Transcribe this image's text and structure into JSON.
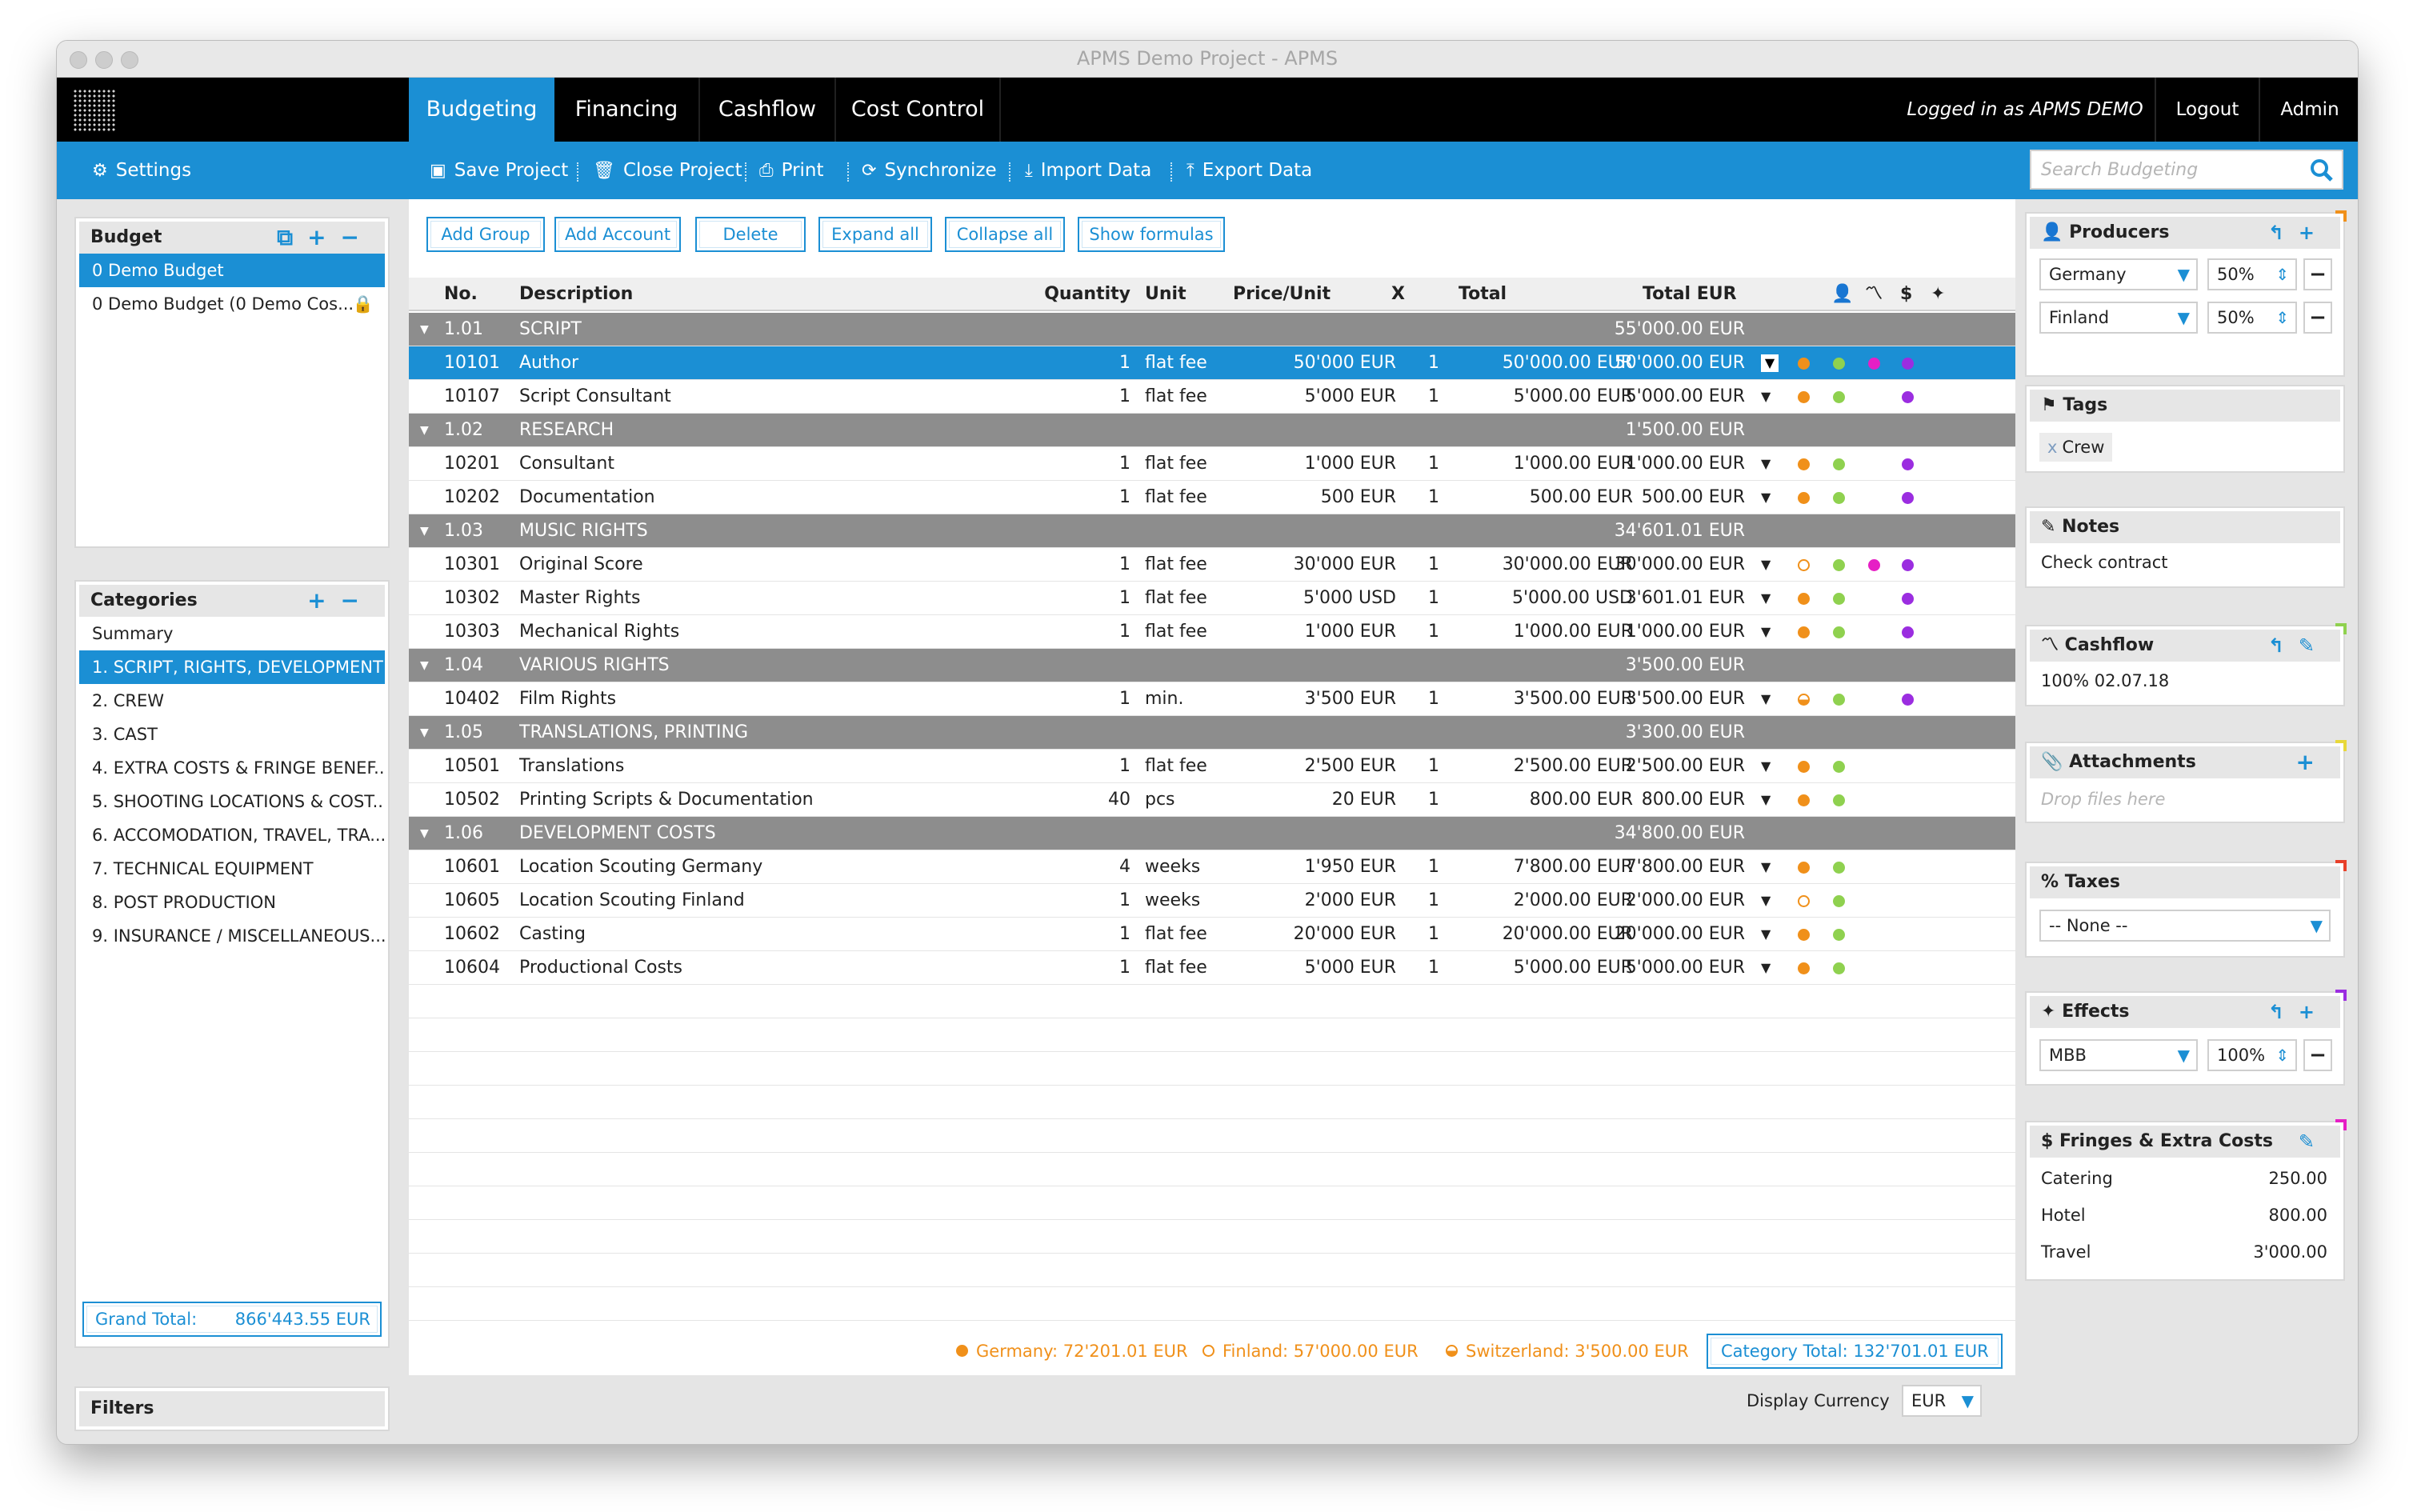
{
  "window": {
    "title": "APMS Demo Project - APMS"
  },
  "nav": {
    "tabs": [
      {
        "label": "Budgeting"
      },
      {
        "label": "Financing"
      },
      {
        "label": "Cashflow"
      },
      {
        "label": "Cost Control"
      }
    ],
    "logged_in": "Logged in as APMS DEMO",
    "logout": "Logout",
    "admin": "Admin"
  },
  "toolbar": {
    "settings": "Settings",
    "save": "Save Project",
    "close": "Close Project",
    "print": "Print",
    "sync": "Synchronize",
    "import": "Import Data",
    "export": "Export Data",
    "search_placeholder": "Search Budgeting"
  },
  "budget": {
    "title": "Budget",
    "items": [
      {
        "label": "0 Demo Budget"
      },
      {
        "label": "0 Demo Budget (0 Demo Cos..."
      }
    ]
  },
  "categories": {
    "title": "Categories",
    "items": [
      {
        "label": "Summary"
      },
      {
        "label": "1. SCRIPT, RIGHTS, DEVELOPMENT"
      },
      {
        "label": "2. CREW"
      },
      {
        "label": "3. CAST"
      },
      {
        "label": "4. EXTRA COSTS & FRINGE BENEF..."
      },
      {
        "label": "5. SHOOTING LOCATIONS & COST..."
      },
      {
        "label": "6. ACCOMODATION, TRAVEL, TRA..."
      },
      {
        "label": "7. TECHNICAL EQUIPMENT"
      },
      {
        "label": "8. POST PRODUCTION"
      },
      {
        "label": "9. INSURANCE / MISCELLANEOUS..."
      }
    ],
    "grand_total_label": "Grand Total:",
    "grand_total_value": "866'443.55 EUR"
  },
  "filters": {
    "title": "Filters"
  },
  "actions": {
    "add_group": "Add Group",
    "add_account": "Add Account",
    "delete": "Delete",
    "expand_all": "Expand all",
    "collapse_all": "Collapse all",
    "show_formulas": "Show formulas"
  },
  "table": {
    "headers": {
      "no": "No.",
      "description": "Description",
      "quantity": "Quantity",
      "unit": "Unit",
      "price": "Price/Unit",
      "x": "X",
      "total": "Total",
      "total_eur": "Total EUR"
    },
    "rows": [
      {
        "type": "group",
        "no": "1.01",
        "desc": "SCRIPT",
        "total_eur": "55'000.00 EUR"
      },
      {
        "type": "item",
        "no": "10101",
        "desc": "Author",
        "qty": "1",
        "unit": "flat fee",
        "price": "50'000 EUR",
        "x": "1",
        "total": "50'000.00 EUR",
        "total_eur": "50'000.00 EUR",
        "country": "germany",
        "dots": [
          "orange",
          "green",
          "magenta",
          "purple"
        ],
        "selected": true
      },
      {
        "type": "item",
        "no": "10107",
        "desc": "Script Consultant",
        "qty": "1",
        "unit": "flat fee",
        "price": "5'000 EUR",
        "x": "1",
        "total": "5'000.00 EUR",
        "total_eur": "5'000.00 EUR",
        "country": "germany",
        "dots": [
          "orange",
          "green",
          "",
          "purple"
        ]
      },
      {
        "type": "group",
        "no": "1.02",
        "desc": "RESEARCH",
        "total_eur": "1'500.00 EUR"
      },
      {
        "type": "item",
        "no": "10201",
        "desc": "Consultant",
        "qty": "1",
        "unit": "flat fee",
        "price": "1'000 EUR",
        "x": "1",
        "total": "1'000.00 EUR",
        "total_eur": "1'000.00 EUR",
        "country": "germany",
        "dots": [
          "orange",
          "green",
          "",
          "purple"
        ]
      },
      {
        "type": "item",
        "no": "10202",
        "desc": "Documentation",
        "qty": "1",
        "unit": "flat fee",
        "price": "500 EUR",
        "x": "1",
        "total": "500.00 EUR",
        "total_eur": "500.00 EUR",
        "country": "germany",
        "dots": [
          "orange",
          "green",
          "",
          "purple"
        ]
      },
      {
        "type": "group",
        "no": "1.03",
        "desc": "MUSIC RIGHTS",
        "total_eur": "34'601.01 EUR"
      },
      {
        "type": "item",
        "no": "10301",
        "desc": "Original Score",
        "qty": "1",
        "unit": "flat fee",
        "price": "30'000 EUR",
        "x": "1",
        "total": "30'000.00 EUR",
        "total_eur": "30'000.00 EUR",
        "country": "finland",
        "dots": [
          "orange",
          "green",
          "magenta",
          "purple"
        ]
      },
      {
        "type": "item",
        "no": "10302",
        "desc": "Master Rights",
        "qty": "1",
        "unit": "flat fee",
        "price": "5'000 USD",
        "x": "1",
        "total": "5'000.00 USD",
        "total_eur": "3'601.01 EUR",
        "country": "germany",
        "dots": [
          "orange",
          "green",
          "",
          "purple"
        ]
      },
      {
        "type": "item",
        "no": "10303",
        "desc": "Mechanical Rights",
        "qty": "1",
        "unit": "flat fee",
        "price": "1'000 EUR",
        "x": "1",
        "total": "1'000.00 EUR",
        "total_eur": "1'000.00 EUR",
        "country": "germany",
        "dots": [
          "orange",
          "green",
          "",
          "purple"
        ]
      },
      {
        "type": "group",
        "no": "1.04",
        "desc": "VARIOUS RIGHTS",
        "total_eur": "3'500.00 EUR"
      },
      {
        "type": "item",
        "no": "10402",
        "desc": "Film Rights",
        "qty": "1",
        "unit": "min.",
        "price": "3'500 EUR",
        "x": "1",
        "total": "3'500.00 EUR",
        "total_eur": "3'500.00 EUR",
        "country": "switzerland",
        "dots": [
          "orange",
          "green",
          "",
          "purple"
        ]
      },
      {
        "type": "group",
        "no": "1.05",
        "desc": "TRANSLATIONS, PRINTING",
        "total_eur": "3'300.00 EUR"
      },
      {
        "type": "item",
        "no": "10501",
        "desc": "Translations",
        "qty": "1",
        "unit": "flat fee",
        "price": "2'500 EUR",
        "x": "1",
        "total": "2'500.00 EUR",
        "total_eur": "2'500.00 EUR",
        "country": "germany",
        "dots": [
          "orange",
          "green",
          "",
          ""
        ]
      },
      {
        "type": "item",
        "no": "10502",
        "desc": "Printing Scripts & Documentation",
        "qty": "40",
        "unit": "pcs",
        "price": "20 EUR",
        "x": "1",
        "total": "800.00 EUR",
        "total_eur": "800.00 EUR",
        "country": "germany",
        "dots": [
          "orange",
          "green",
          "",
          ""
        ]
      },
      {
        "type": "group",
        "no": "1.06",
        "desc": "DEVELOPMENT COSTS",
        "total_eur": "34'800.00 EUR"
      },
      {
        "type": "item",
        "no": "10601",
        "desc": "Location Scouting Germany",
        "qty": "4",
        "unit": "weeks",
        "price": "1'950 EUR",
        "x": "1",
        "total": "7'800.00 EUR",
        "total_eur": "7'800.00 EUR",
        "country": "germany",
        "dots": [
          "orange",
          "green",
          "",
          ""
        ]
      },
      {
        "type": "item",
        "no": "10605",
        "desc": "Location Scouting Finland",
        "qty": "1",
        "unit": "weeks",
        "price": "2'000 EUR",
        "x": "1",
        "total": "2'000.00 EUR",
        "total_eur": "2'000.00 EUR",
        "country": "finland",
        "dots": [
          "orange",
          "green",
          "",
          ""
        ]
      },
      {
        "type": "item",
        "no": "10602",
        "desc": "Casting",
        "qty": "1",
        "unit": "flat fee",
        "price": "20'000 EUR",
        "x": "1",
        "total": "20'000.00 EUR",
        "total_eur": "20'000.00 EUR",
        "country": "germany",
        "dots": [
          "orange",
          "green",
          "",
          ""
        ]
      },
      {
        "type": "item",
        "no": "10604",
        "desc": "Productional Costs",
        "qty": "1",
        "unit": "flat fee",
        "price": "5'000 EUR",
        "x": "1",
        "total": "5'000.00 EUR",
        "total_eur": "5'000.00 EUR",
        "country": "germany",
        "dots": [
          "orange",
          "green",
          "",
          ""
        ]
      }
    ]
  },
  "footer": {
    "germany": "Germany: 72'201.01 EUR",
    "finland": "Finland: 57'000.00 EUR",
    "switzerland": "Switzerland: 3'500.00 EUR",
    "category_total_label": "Category Total:",
    "category_total_value": "132'701.01 EUR",
    "display_currency_label": "Display Currency",
    "display_currency": "EUR"
  },
  "producers": {
    "title": "Producers",
    "rows": [
      {
        "country": "Germany",
        "pct": "50%"
      },
      {
        "country": "Finland",
        "pct": "50%"
      }
    ]
  },
  "tags": {
    "title": "Tags",
    "x": "x",
    "tag": "Crew"
  },
  "notes": {
    "title": "Notes",
    "text": "Check contract"
  },
  "cashflow": {
    "title": "Cashflow",
    "text": "100% 02.07.18"
  },
  "attachments": {
    "title": "Attachments",
    "placeholder": "Drop files here"
  },
  "taxes": {
    "title": "Taxes",
    "value": "-- None --"
  },
  "effects": {
    "title": "Effects",
    "name": "MBB",
    "pct": "100%"
  },
  "fringes": {
    "title": "Fringes & Extra Costs",
    "rows": [
      {
        "label": "Catering",
        "value": "250.00"
      },
      {
        "label": "Hotel",
        "value": "800.00"
      },
      {
        "label": "Travel",
        "value": "3'000.00"
      }
    ]
  },
  "colors": {
    "accent": "#1b8fd4",
    "germany": "#f0901a",
    "green": "#8fd14f",
    "magenta": "#e61fc5",
    "purple": "#9b2de0",
    "group_row": "#8d8d8d"
  }
}
